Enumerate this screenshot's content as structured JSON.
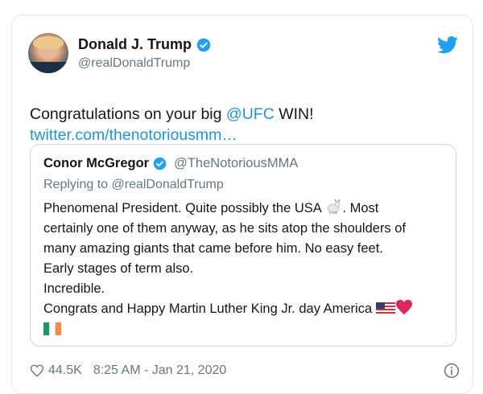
{
  "author": {
    "name": "Donald J. Trump",
    "handle": "@realDonaldTrump",
    "verified": true
  },
  "tweet": {
    "text_before": "Congratulations on your big ",
    "mention": "@UFC",
    "text_after": " WIN!",
    "link": "twitter.com/thenotoriousmm…"
  },
  "quoted": {
    "name": "Conor McGregor",
    "handle": "@TheNotoriousMMA",
    "replying_to": "Replying to @realDonaldTrump",
    "lines": [
      "Phenomenal President. Quite possibly the USA",
      ". Most",
      "certainly one of them anyway, as he sits atop the shoulders of",
      "many amazing giants that came before him. No easy feet.",
      "Early stages of term also.",
      "Incredible.",
      "Congrats and Happy Martin Luther King Jr. day America"
    ]
  },
  "meta": {
    "likes": "44.5K",
    "timestamp": "8:25 AM - Jan 21, 2020"
  },
  "icons": [
    "verified-icon",
    "twitter-logo-icon",
    "goat-emoji",
    "us-flag-emoji",
    "heart-emoji",
    "ireland-flag-emoji",
    "heart-icon",
    "info-icon"
  ],
  "colors": {
    "link": "#1b95e0",
    "secondary": "#657786",
    "border": "#e1e8ed",
    "verified": "#1da1f2",
    "heart": "#e0245e"
  }
}
